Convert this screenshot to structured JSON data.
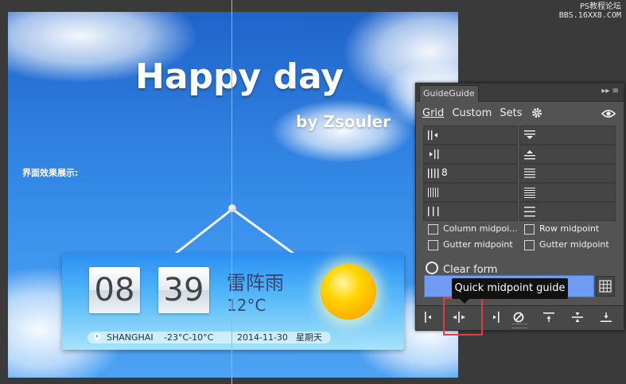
{
  "watermark": {
    "line1": "PS教程论坛",
    "line2": "BBS.16XX8.COM"
  },
  "canvas": {
    "title": "Happy day",
    "byline": "by Zsouler",
    "caption": "界面效果展示:",
    "widget": {
      "hour": "08",
      "minute": "39",
      "condition": "雷阵雨",
      "temperature": "12°C",
      "city": "SHANGHAI",
      "range": "-23°C-10°C",
      "date": "2014-11-30",
      "weekday": "星期天"
    }
  },
  "panel": {
    "title": "GuideGuide",
    "tabs": [
      "Grid",
      "Custom",
      "Sets"
    ],
    "column_count": "8",
    "checkboxes": {
      "column_midpoint": "Column midpoi...",
      "row_midpoint": "Row midpoint",
      "gutter_midpoint_col": "Gutter midpoint",
      "gutter_midpoint_row": "Gutter midpoint"
    },
    "clear_form": "Clear form",
    "tooltip": "Quick midpoint guide"
  },
  "colors": {
    "guide": "#5cd7e6",
    "apply_bar": "#6f9cf2",
    "highlight": "#e23c3c"
  }
}
